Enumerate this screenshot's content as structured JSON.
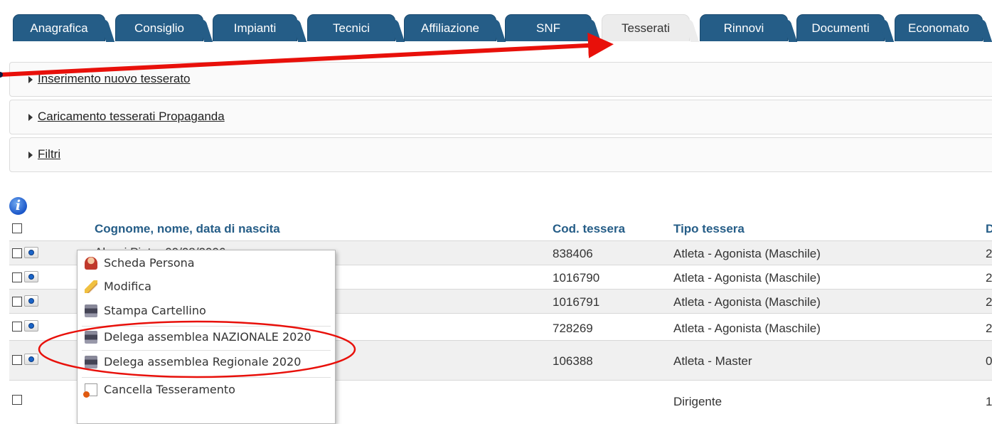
{
  "tabs": [
    {
      "label": "Anagrafica",
      "active": false
    },
    {
      "label": "Consiglio",
      "active": false
    },
    {
      "label": "Impianti",
      "active": false
    },
    {
      "label": "Tecnici",
      "active": false
    },
    {
      "label": "Affiliazione",
      "active": false
    },
    {
      "label": "SNF",
      "active": false
    },
    {
      "label": "Tesserati",
      "active": true
    },
    {
      "label": "Rinnovi",
      "active": false
    },
    {
      "label": "Documenti",
      "active": false
    },
    {
      "label": "Economato",
      "active": false
    }
  ],
  "panels": {
    "inserimento": "Inserimento nuovo tesserato",
    "caricamento": "Caricamento tesserati Propaganda",
    "filtri": "Filtri"
  },
  "table": {
    "headers": {
      "name": "Cognome, nome, data di nascita",
      "code": "Cod. tessera",
      "type": "Tipo tessera",
      "extra": "D"
    },
    "rows": [
      {
        "name": "Alessi Pietro 00/08/2006",
        "code": "838406",
        "type": "Atleta - Agonista (Maschile)",
        "extra": "2"
      },
      {
        "name": "",
        "code": "1016790",
        "type": "Atleta - Agonista (Maschile)",
        "extra": "2"
      },
      {
        "name": "",
        "code": "1016791",
        "type": "Atleta - Agonista (Maschile)",
        "extra": "2"
      },
      {
        "name": "",
        "code": "728269",
        "type": "Atleta - Agonista (Maschile)",
        "extra": "2"
      },
      {
        "name": "",
        "code": "106388",
        "type": "Atleta - Master",
        "extra": "0"
      },
      {
        "name": "",
        "code": "",
        "type": "Dirigente",
        "extra": "1"
      }
    ]
  },
  "context_menu": {
    "items": [
      {
        "label": "Scheda Persona",
        "icon": "person-icon"
      },
      {
        "label": "Modifica",
        "icon": "pencil-icon"
      },
      {
        "label": "Stampa Cartellino",
        "icon": "printer-icon"
      },
      {
        "label": "Delega assemblea NAZIONALE 2020",
        "icon": "printer-icon"
      },
      {
        "label": "Delega assemblea Regionale 2020",
        "icon": "printer-icon"
      },
      {
        "label": "Cancella Tesseramento",
        "icon": "cancel-icon"
      }
    ]
  },
  "colors": {
    "tab_blue": "#255d87",
    "header_blue": "#255d87",
    "annotation_red": "#e8100a"
  }
}
